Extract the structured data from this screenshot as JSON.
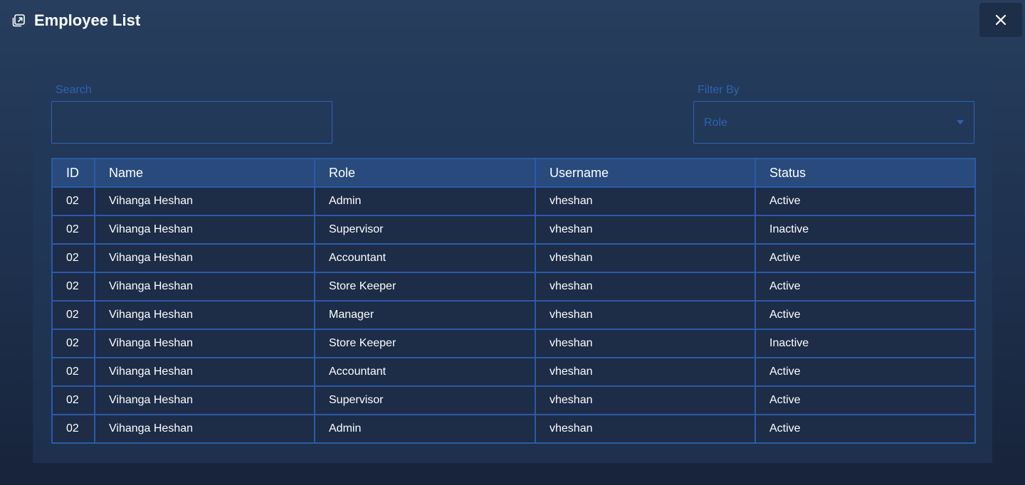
{
  "header": {
    "title": "Employee List"
  },
  "filters": {
    "search_label": "Search",
    "search_value": "",
    "filter_label": "Filter By",
    "filter_value": "Role"
  },
  "table": {
    "columns": [
      "ID",
      "Name",
      "Role",
      "Username",
      "Status"
    ],
    "rows": [
      {
        "id": "02",
        "name": "Vihanga Heshan",
        "role": "Admin",
        "username": "vheshan",
        "status": "Active"
      },
      {
        "id": "02",
        "name": "Vihanga Heshan",
        "role": "Supervisor",
        "username": "vheshan",
        "status": "Inactive"
      },
      {
        "id": "02",
        "name": "Vihanga Heshan",
        "role": "Accountant",
        "username": "vheshan",
        "status": "Active"
      },
      {
        "id": "02",
        "name": "Vihanga Heshan",
        "role": "Store Keeper",
        "username": "vheshan",
        "status": "Active"
      },
      {
        "id": "02",
        "name": "Vihanga Heshan",
        "role": "Manager",
        "username": "vheshan",
        "status": "Active"
      },
      {
        "id": "02",
        "name": "Vihanga Heshan",
        "role": "Store Keeper",
        "username": "vheshan",
        "status": "Inactive"
      },
      {
        "id": "02",
        "name": "Vihanga Heshan",
        "role": "Accountant",
        "username": "vheshan",
        "status": "Active"
      },
      {
        "id": "02",
        "name": "Vihanga Heshan",
        "role": "Supervisor",
        "username": "vheshan",
        "status": "Active"
      },
      {
        "id": "02",
        "name": "Vihanga Heshan",
        "role": "Admin",
        "username": "vheshan",
        "status": "Active"
      }
    ]
  },
  "icons": {
    "title": "open-external-icon",
    "close": "close-icon",
    "dropdown": "chevron-down-icon"
  },
  "colors": {
    "background": "#1f3350",
    "accent": "#2f63b4",
    "table_header": "#284a7c",
    "table_cell": "#1d2c47",
    "text": "#ffffff"
  }
}
